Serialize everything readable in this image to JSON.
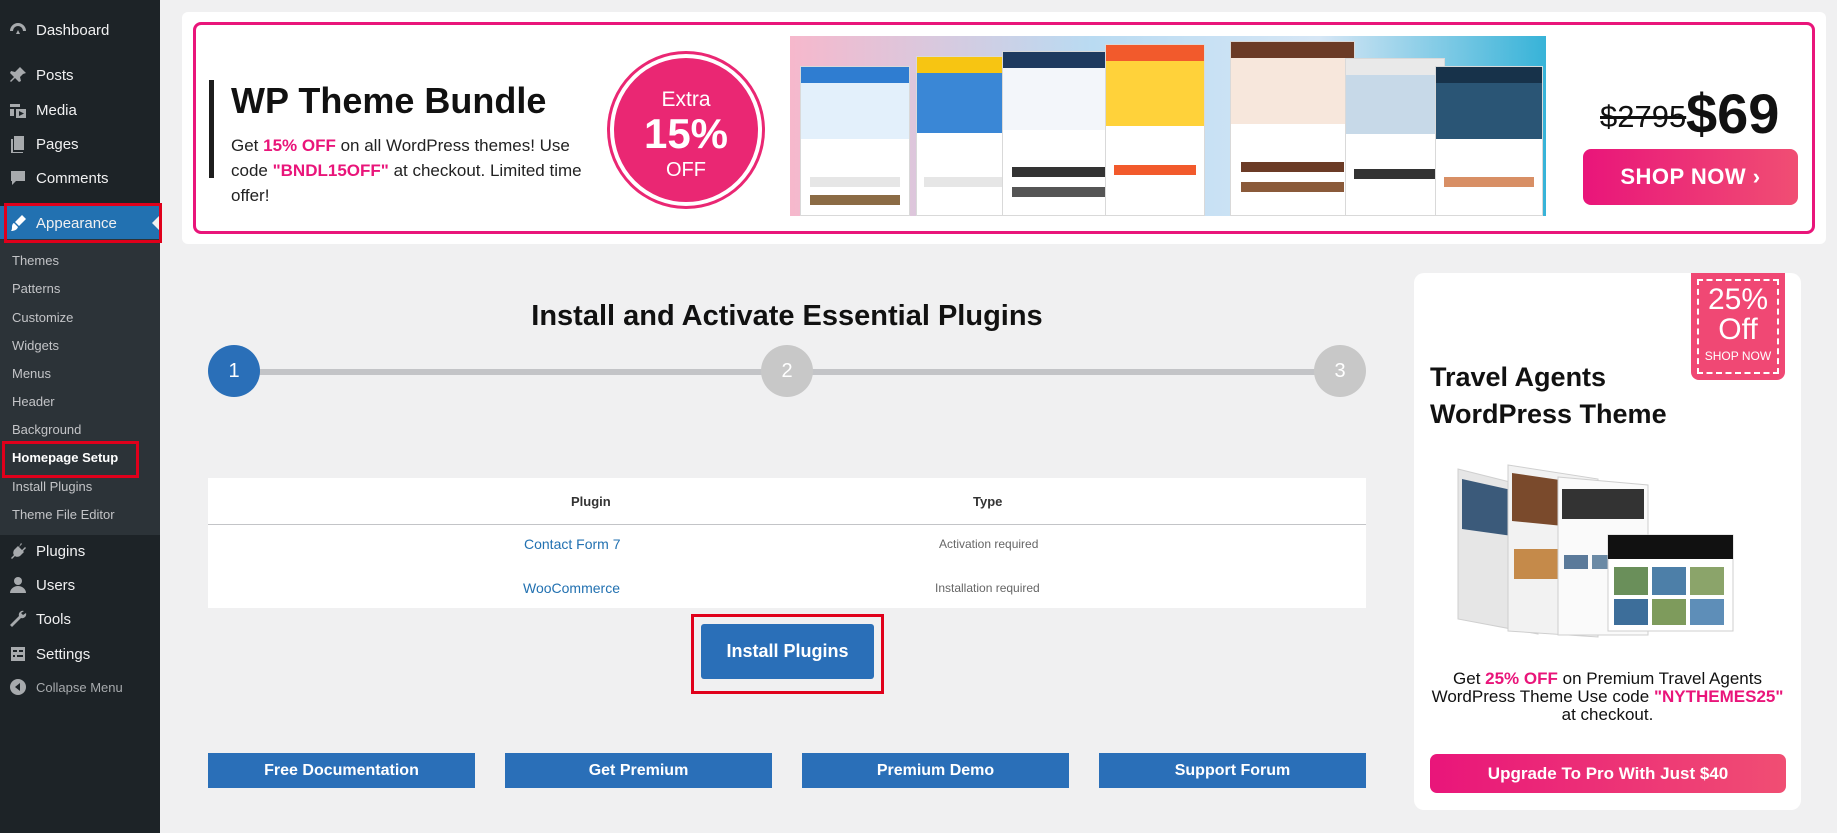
{
  "sidebar": {
    "items": [
      {
        "label": "Dashboard",
        "icon": "dashboard-icon"
      },
      {
        "label": "Posts",
        "icon": "pin-icon"
      },
      {
        "label": "Media",
        "icon": "media-icon"
      },
      {
        "label": "Pages",
        "icon": "pages-icon"
      },
      {
        "label": "Comments",
        "icon": "comment-icon"
      },
      {
        "label": "Appearance",
        "icon": "brush-icon"
      },
      {
        "label": "Plugins",
        "icon": "plugin-icon"
      },
      {
        "label": "Users",
        "icon": "user-icon"
      },
      {
        "label": "Tools",
        "icon": "wrench-icon"
      },
      {
        "label": "Settings",
        "icon": "settings-icon"
      }
    ],
    "submenu": [
      "Themes",
      "Patterns",
      "Customize",
      "Widgets",
      "Menus",
      "Header",
      "Background",
      "Homepage Setup",
      "Install Plugins",
      "Theme File Editor"
    ],
    "collapse_label": "Collapse Menu"
  },
  "banner": {
    "title": "WP Theme Bundle",
    "desc_1": "Get ",
    "desc_highlight": "15% OFF",
    "desc_2": " on all WordPress themes! Use code ",
    "desc_code": "\"BNDL15OFF\"",
    "desc_3": " at checkout. Limited time offer!",
    "badge_top": "Extra",
    "badge_mid": "15%",
    "badge_bottom": "OFF",
    "old_price": "$2795",
    "new_price": "$69",
    "cta": "SHOP NOW ›"
  },
  "main": {
    "title": "Install and Activate Essential Plugins",
    "steps": [
      "1",
      "2",
      "3"
    ],
    "table": {
      "headers": [
        "Plugin",
        "Type"
      ],
      "rows": [
        {
          "plugin": "Contact Form 7",
          "type": "Activation required"
        },
        {
          "plugin": "WooCommerce",
          "type": "Installation required"
        }
      ]
    },
    "install_button": "Install Plugins",
    "links": [
      "Free Documentation",
      "Get Premium",
      "Premium Demo",
      "Support Forum"
    ]
  },
  "promo": {
    "badge_big": "25% Off",
    "badge_small": "SHOP NOW",
    "title": "Travel Agents WordPress Theme",
    "text_1": "Get ",
    "text_highlight": "25% OFF",
    "text_2": " on Premium Travel Agents WordPress Theme Use code ",
    "text_code": "\"NYTHEMES25\"",
    "text_3": " at checkout.",
    "cta": "Upgrade To Pro With Just $40"
  },
  "colors": {
    "sidebar_bg": "#1d2327",
    "active_blue": "#2271b1",
    "button_blue": "#2a6fb8",
    "brand_pink": "#e9157a",
    "highlight_red": "#e0001b"
  }
}
